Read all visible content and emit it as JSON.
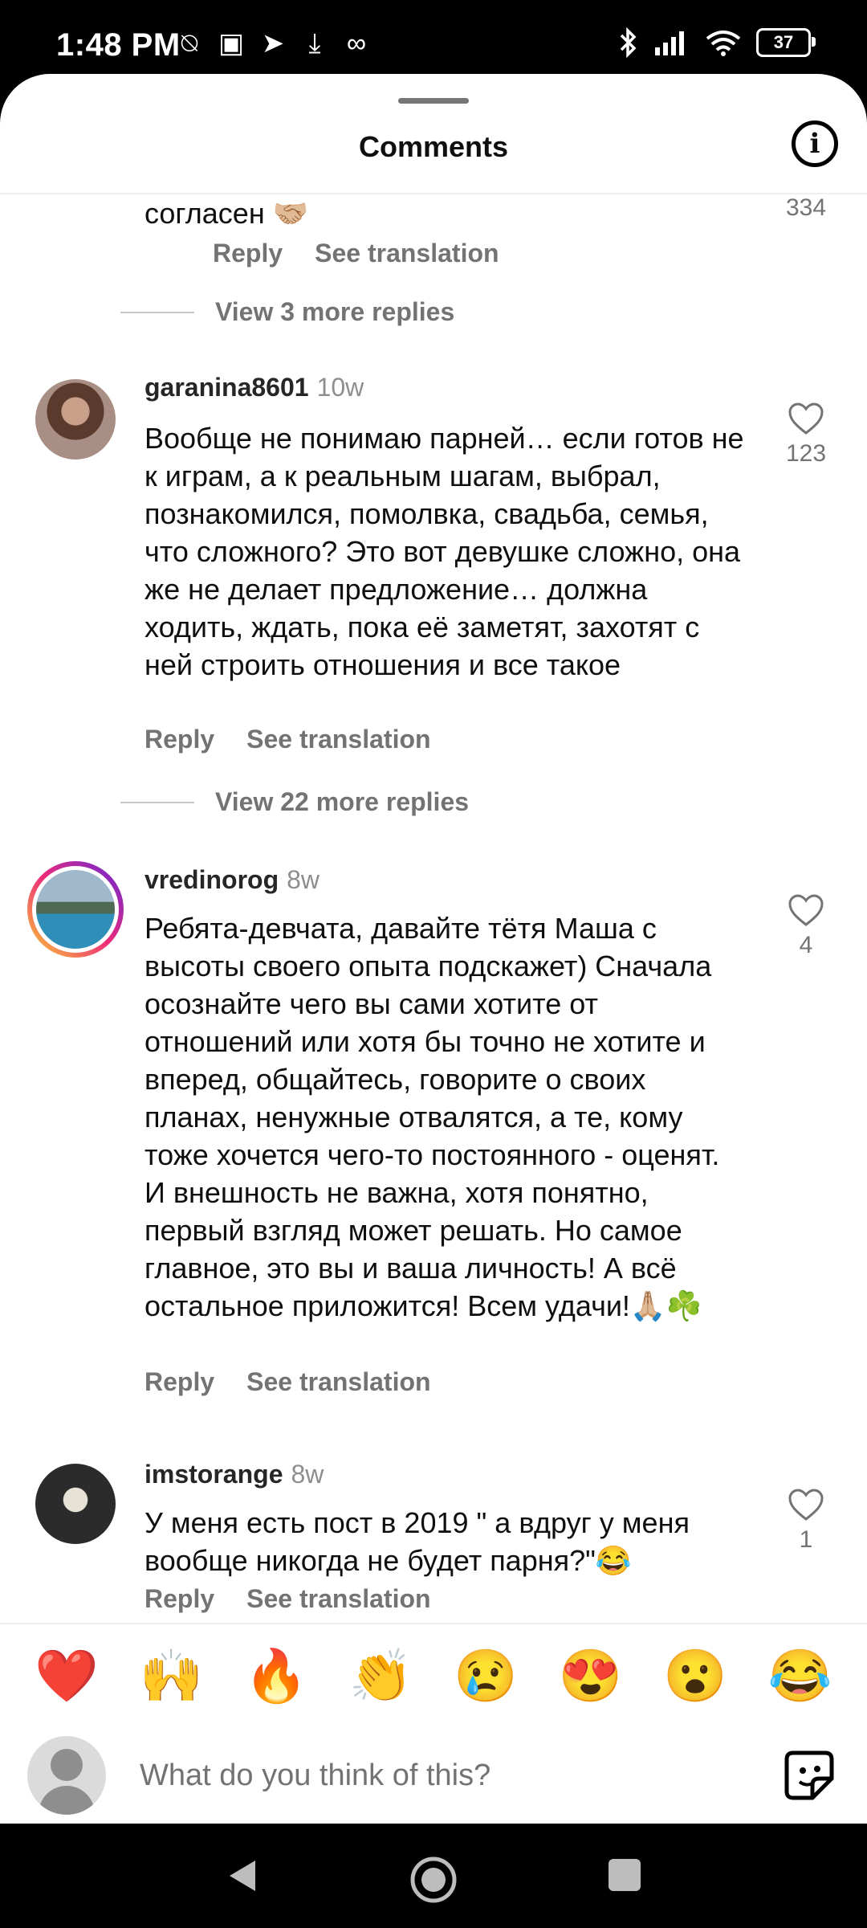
{
  "status_bar": {
    "time": "1:48 PM",
    "battery": "37"
  },
  "sheet": {
    "title": "Comments"
  },
  "comments": {
    "partial": {
      "text": "согласен 🤝🏼",
      "likes": "334",
      "reply": "Reply",
      "translate": "See translation",
      "view_more": "View 3 more replies"
    },
    "items": [
      {
        "username": "garanina8601",
        "time": "10w",
        "text": "Вообще не понимаю парней… если готов не к играм, а к реальным шагам, выбрал, познакомился, помолвка, свадьба, семья, что сложного? Это вот девушке сложно, она же не делает предложение… должна ходить, ждать, пока её заметят, захотят с ней строить отношения и все такое",
        "likes": "123",
        "reply": "Reply",
        "translate": "See translation",
        "view_more": "View 22 more replies"
      },
      {
        "username": "vredinorog",
        "time": "8w",
        "text": "Ребята-девчата, давайте тётя Маша с высоты своего опыта подскажет) Сначала осознайте чего вы сами хотите от отношений или хотя бы точно не хотите и вперед, общайтесь, говорите о своих планах, ненужные отвалятся, а те, кому тоже хочется чего-то постоянного - оценят. И внешность не важна, хотя понятно, первый взгляд может решать. Но самое главное, это вы и ваша личность! А всё остальное приложится! Всем удачи!🙏🏼☘️",
        "likes": "4",
        "reply": "Reply",
        "translate": "See translation"
      },
      {
        "username": "imstorange",
        "time": "8w",
        "text": "У меня есть пост в 2019 \" а вдруг у меня вообще никогда не будет парня?\"😂",
        "likes": "1",
        "reply": "Reply",
        "translate": "See translation"
      }
    ]
  },
  "emoji_bar": [
    "❤️",
    "🙌",
    "🔥",
    "👏",
    "😢",
    "😍",
    "😮",
    "😂"
  ],
  "input": {
    "placeholder": "What do you think of this?"
  }
}
